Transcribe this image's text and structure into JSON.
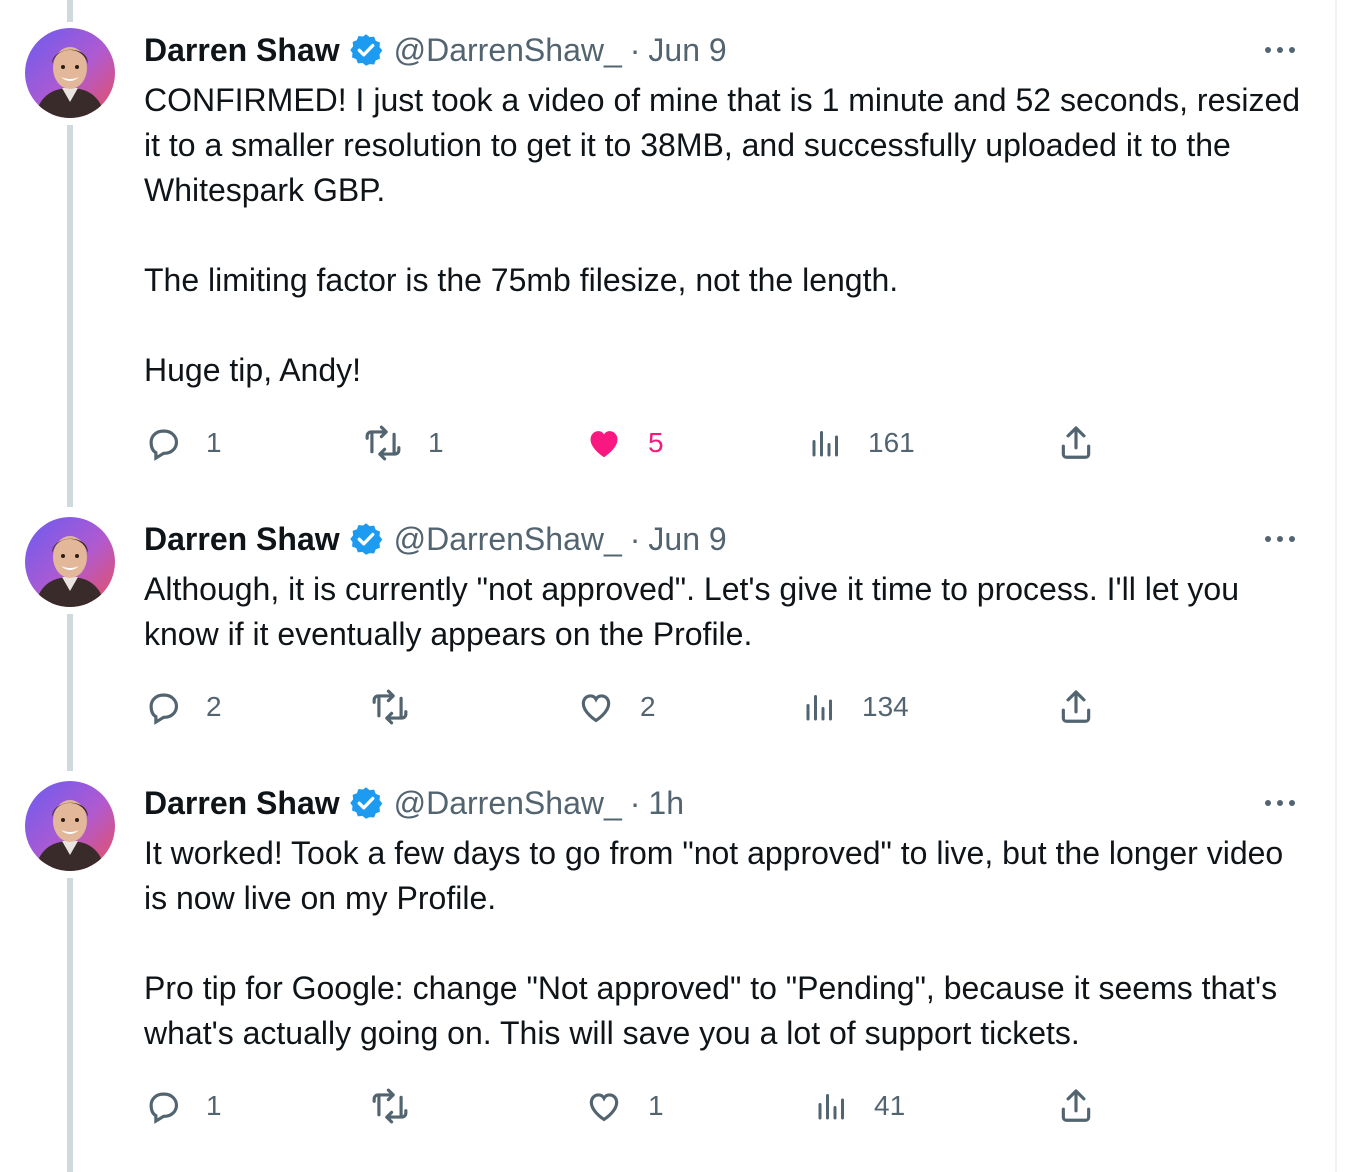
{
  "author": {
    "name": "Darren Shaw",
    "handle": "@DarrenShaw_",
    "verified_icon": "verified-badge-icon"
  },
  "colors": {
    "verified": "#1d9bf0",
    "like_active": "#f91880",
    "muted": "#536471",
    "thread_line": "#cfd9de"
  },
  "tweets": [
    {
      "time": "Jun 9",
      "paragraphs": [
        "CONFIRMED! I just took a video of mine that is 1 minute and 52 seconds, resized it to a smaller resolution to get it to 38MB, and successfully uploaded it to the Whitespark GBP.",
        "The limiting factor is the 75mb filesize, not the length.",
        "Huge tip, Andy!"
      ],
      "replies": "1",
      "reposts": "1",
      "likes": "5",
      "liked": true,
      "views": "161"
    },
    {
      "time": "Jun 9",
      "paragraphs": [
        "Although, it is currently \"not approved\". Let's give it time to process. I'll let you know if it eventually appears on the Profile."
      ],
      "replies": "2",
      "reposts": "",
      "likes": "2",
      "liked": false,
      "views": "134"
    },
    {
      "time": "1h",
      "paragraphs": [
        "It worked! Took a few days to go from \"not approved\" to live, but the longer video is now live on my Profile.",
        "Pro tip for Google: change \"Not approved\" to \"Pending\", because it seems that's what's actually going on. This will save you a lot of support tickets."
      ],
      "replies": "1",
      "reposts": "",
      "likes": "1",
      "liked": false,
      "views": "41"
    }
  ]
}
